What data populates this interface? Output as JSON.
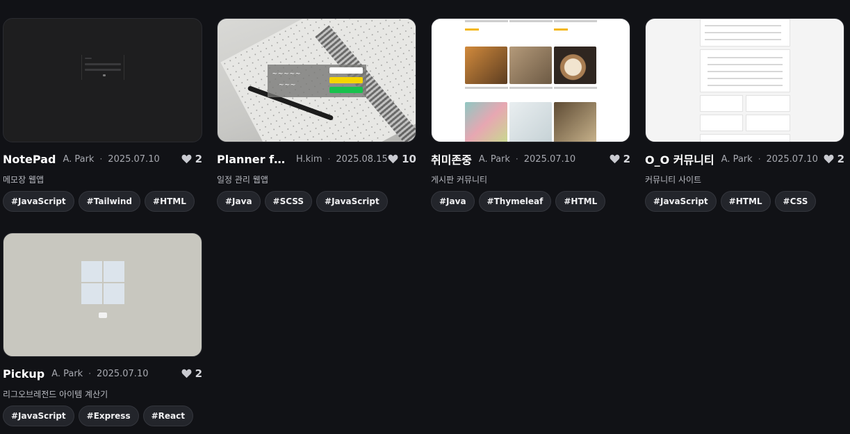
{
  "projects": [
    {
      "title": "NotePad",
      "author": "A. Park",
      "separator": "·",
      "date": "2025.07.10",
      "likes": "2",
      "description": "메모장 웹앱",
      "tags": [
        "#JavaScript",
        "#Tailwind",
        "#HTML"
      ]
    },
    {
      "title": "Planner fo···",
      "author": "H.kim",
      "separator": "·",
      "date": "2025.08.15",
      "likes": "10",
      "description": "일정 관리 웹앱",
      "tags": [
        "#Java",
        "#SCSS",
        "#JavaScript"
      ]
    },
    {
      "title": "취미존중",
      "author": "A. Park",
      "separator": "·",
      "date": "2025.07.10",
      "likes": "2",
      "description": "게시판 커뮤니티",
      "tags": [
        "#Java",
        "#Thymeleaf",
        "#HTML"
      ]
    },
    {
      "title": "O_O 커뮤니티",
      "author": "A. Park",
      "separator": "·",
      "date": "2025.07.10",
      "likes": "2",
      "description": "커뮤니티 사이트",
      "tags": [
        "#JavaScript",
        "#HTML",
        "#CSS"
      ]
    },
    {
      "title": "Pickup",
      "author": "A. Park",
      "separator": "·",
      "date": "2025.07.10",
      "likes": "2",
      "description": "리그오브레전드 아이템 계산기",
      "tags": [
        "#JavaScript",
        "#Express",
        "#React"
      ]
    }
  ],
  "colors": {
    "background": "#111216",
    "tag_bg": "#23252b",
    "heart": "#c9cad0"
  },
  "icons": {
    "like": "heart-icon"
  }
}
